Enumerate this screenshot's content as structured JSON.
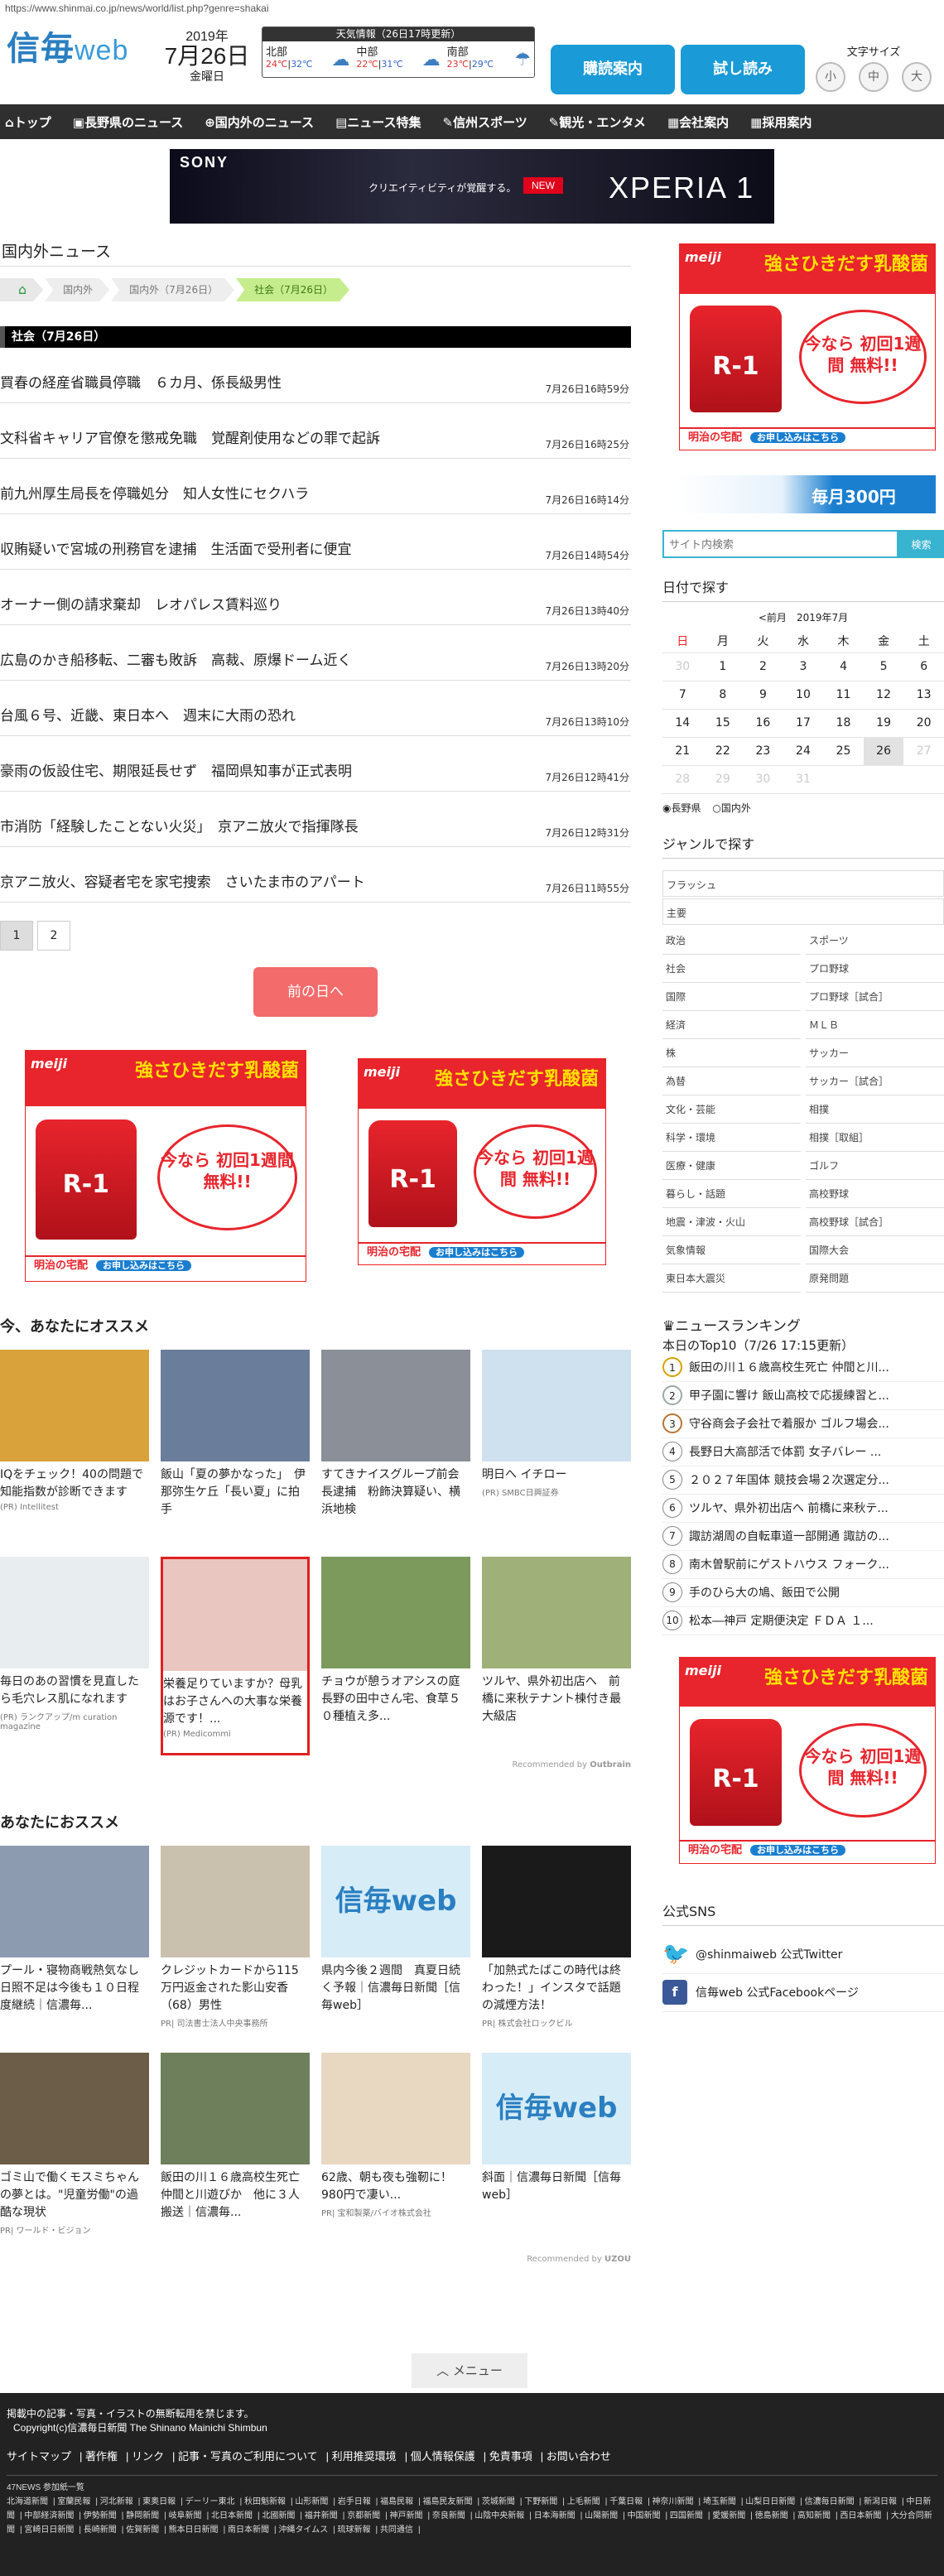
{
  "url": "https://www.shinmai.co.jp/news/world/list.php?genre=shakai",
  "header": {
    "logo": "信毎",
    "logo_web": "web",
    "year": "2019年",
    "month_day": "7月26日",
    "weekday": "金曜日",
    "weather": {
      "title": "天気情報（26日17時更新）",
      "areas": [
        {
          "name": "北部",
          "hi": "24℃",
          "lo": "32℃"
        },
        {
          "name": "中部",
          "hi": "22℃",
          "lo": "31℃"
        },
        {
          "name": "南部",
          "hi": "23℃",
          "lo": "29℃"
        }
      ]
    },
    "btn_subscribe": "購読案内",
    "btn_trial": "試し読み",
    "font_size_label": "文字サイズ",
    "font_small": "小",
    "font_medium": "中",
    "font_large": "大"
  },
  "nav": [
    "トップ",
    "長野県のニュース",
    "国内外のニュース",
    "ニュース特集",
    "信州スポーツ",
    "観光・エンタメ",
    "会社案内",
    "採用案内"
  ],
  "top_ad": {
    "brand": "SONY",
    "catch": "クリエイティビティが覚醒する。",
    "new": "NEW",
    "product": "XPERIA 1"
  },
  "main": {
    "section_title": "国内外ニュース",
    "breadcrumb": [
      "国内外",
      "国内外（7月26日）",
      "社会（7月26日）"
    ],
    "list_header": "社会（7月26日）",
    "news": [
      {
        "title": "買春の経産省職員停職　６カ月、係長級男性",
        "time": "7月26日16時59分"
      },
      {
        "title": "文科省キャリア官僚を懲戒免職　覚醒剤使用などの罪で起訴",
        "time": "7月26日16時25分"
      },
      {
        "title": "前九州厚生局長を停職処分　知人女性にセクハラ",
        "time": "7月26日16時14分"
      },
      {
        "title": "収賄疑いで宮城の刑務官を逮捕　生活面で受刑者に便宜",
        "time": "7月26日14時54分"
      },
      {
        "title": "オーナー側の請求棄却　レオパレス賃料巡り",
        "time": "7月26日13時40分"
      },
      {
        "title": "広島のかき船移転、二審も敗訴　高裁、原爆ドーム近く",
        "time": "7月26日13時20分"
      },
      {
        "title": "台風６号、近畿、東日本へ　週末に大雨の恐れ",
        "time": "7月26日13時10分"
      },
      {
        "title": "豪雨の仮設住宅、期限延長せず　福岡県知事が正式表明",
        "time": "7月26日12時41分"
      },
      {
        "title": "市消防「経験したことない火災」　京アニ放火で指揮隊長",
        "time": "7月26日12時31分"
      },
      {
        "title": "京アニ放火、容疑者宅を家宅捜索　さいたま市のアパート",
        "time": "7月26日11時55分"
      }
    ],
    "pages": [
      "1",
      "2"
    ],
    "prev_day": "前の日へ"
  },
  "meiji_ad": {
    "logo": "meiji",
    "catch": "強さひきだす乳酸菌",
    "product": "R-1",
    "offer": "今なら 初回1週間 無料!!",
    "foot": "明治の宅配",
    "apply": "お申し込みはこちら"
  },
  "reco1": {
    "title": "今、あなたにオススメ",
    "cards": [
      {
        "text": "IQをチェック！40の問題で知能指数が診断できます",
        "src": "(PR) Intellitest",
        "color": "#d9a23a"
      },
      {
        "text": "飯山「夏の夢かなった」　伊那弥生ケ丘「長い夏」に拍手",
        "src": "",
        "color": "#6a7d9a"
      },
      {
        "text": "すてきナイスグループ前会長逮捕　粉飾決算疑い、横浜地検",
        "src": "",
        "color": "#8a8f98"
      },
      {
        "text": "明日へ イチロー",
        "src": "(PR) SMBC日興証券",
        "color": "#cfe0ef"
      },
      {
        "text": "毎日のあの習慣を見直したら毛穴レス肌になれます",
        "src": "(PR) ランクアップ/m curation magazine",
        "color": "#e8eef0"
      },
      {
        "text": "栄養足りていますか？母乳はお子さんへの大事な栄養源です！...",
        "src": "(PR) Medicommi",
        "color": "#e9c7c0"
      },
      {
        "text": "チョウが憩うオアシスの庭　長野の田中さん宅、食草５０種植え多...",
        "src": "",
        "color": "#7b9a5c"
      },
      {
        "text": "ツルヤ、県外初出店へ　前橋に来秋テナント棟付き最大級店",
        "src": "",
        "color": "#9fb078"
      }
    ],
    "recommended": "Recommended by",
    "provider": "Outbrain"
  },
  "reco2": {
    "title": "あなたにおススメ",
    "cards": [
      {
        "text": "プール・寝物商戦熱気なし　日照不足は今後も１０日程度継続｜信濃毎...",
        "src": "",
        "color": "#8d9bb0"
      },
      {
        "text": "クレジットカードから115万円返金された影山安香（68）男性",
        "src": "PR| 司法書士法人中央事務所",
        "color": "#c9c0ad"
      },
      {
        "text": "県内今後２週間　真夏日続く予報｜信濃毎日新聞［信毎web］",
        "src": "",
        "color": "#d6ecf7"
      },
      {
        "text": "「加熱式たばこの時代は終わった！」インスタで話題の減煙方法！",
        "src": "PR| 株式会社ロックビル",
        "color": "#1a1a1a"
      },
      {
        "text": "ゴミ山で働くモスミちゃんの夢とは。\"児童労働\"の過酷な現状",
        "src": "PR| ワールド・ビジョン",
        "color": "#6b5d48"
      },
      {
        "text": "飯田の川１６歳高校生死亡　仲間と川遊びか　他に３人搬送｜信濃毎...",
        "src": "",
        "color": "#6e7f5c"
      },
      {
        "text": "62歳、朝も夜も強靭に！980円で凄い...",
        "src": "PR| 宝和製薬/バイオ株式会社",
        "color": "#e8d8c2"
      },
      {
        "text": "斜面｜信濃毎日新聞［信毎web］",
        "src": "",
        "color": "#d6ecf7"
      }
    ],
    "recommended": "Recommended by",
    "provider": "UZOU"
  },
  "side": {
    "banner": "毎月300円",
    "search_placeholder": "サイト内検索",
    "search_btn": "検索",
    "date_title": "日付で探す",
    "cal_prev": "<前月",
    "cal_month": "2019年7月",
    "weekdays": [
      "日",
      "月",
      "火",
      "水",
      "木",
      "金",
      "土"
    ],
    "weeks": [
      [
        "30",
        "1",
        "2",
        "3",
        "4",
        "5",
        "6"
      ],
      [
        "7",
        "8",
        "9",
        "10",
        "11",
        "12",
        "13"
      ],
      [
        "14",
        "15",
        "16",
        "17",
        "18",
        "19",
        "20"
      ],
      [
        "21",
        "22",
        "23",
        "24",
        "25",
        "26",
        "27"
      ],
      [
        "28",
        "29",
        "30",
        "31",
        "",
        "",
        ""
      ]
    ],
    "radio1": "長野県",
    "radio2": "国内外",
    "genre_title": "ジャンルで探す",
    "genre_full": [
      "フラッシュ",
      "主要"
    ],
    "genres": [
      "政治",
      "スポーツ",
      "社会",
      "プロ野球",
      "国際",
      "プロ野球［試合］",
      "経済",
      "ＭＬＢ",
      "株",
      "サッカー",
      "為替",
      "サッカー［試合］",
      "文化・芸能",
      "相撲",
      "科学・環境",
      "相撲［取組］",
      "医療・健康",
      "ゴルフ",
      "暮らし・話題",
      "高校野球",
      "地震・津波・火山",
      "高校野球［試合］",
      "気象情報",
      "国際大会",
      "東日本大震災",
      "原発問題"
    ],
    "rank_title": "ニュースランキング",
    "rank_sub": "本日のTop10（7/26 17:15更新）",
    "ranking": [
      "飯田の川１６歳高校生死亡 仲間と川...",
      "甲子園に響け 飯山高校で応援練習と...",
      "守谷商会子会社で着服か ゴルフ場会...",
      "長野日大高部活で体罰 女子バレー ...",
      "２０２７年国体 競技会場２次選定分...",
      "ツルヤ、県外初出店へ 前橋に来秋テ...",
      "諏訪湖周の自転車道一部開通 諏訪の...",
      "南木曽駅前にゲストハウス フォーク...",
      "手のひら大の鳩、飯田で公開",
      "松本―神戸 定期便決定 ＦＤＡ １..."
    ],
    "sns_title": "公式SNS",
    "twitter": "@shinmaiweb 公式Twitter",
    "facebook": "信毎web 公式Facebookページ"
  },
  "footer": {
    "menu": "メニュー",
    "notice": "掲載中の記事・写真・イラストの無断転用を禁じます。",
    "copyright": "Copyright(c)信濃毎日新聞 The Shinano Mainichi Shimbun",
    "links": [
      "サイトマップ",
      "著作権",
      "リンク",
      "記事・写真のご利用について",
      "利用推奨環境",
      "個人情報保護",
      "免責事項",
      "お問い合わせ"
    ],
    "partners_title": "47NEWS 参加紙一覧",
    "partners": [
      "北海道新聞",
      "室蘭民報",
      "河北新報",
      "東奥日報",
      "デーリー東北",
      "秋田魁新報",
      "山形新聞",
      "岩手日報",
      "福島民報",
      "福島民友新聞",
      "茨城新聞",
      "下野新聞",
      "上毛新聞",
      "千葉日報",
      "神奈川新聞",
      "埼玉新聞",
      "山梨日日新聞",
      "信濃毎日新聞",
      "新潟日報",
      "中日新聞",
      "中部経済新聞",
      "伊勢新聞",
      "静岡新聞",
      "岐阜新聞",
      "北日本新聞",
      "北國新聞",
      "福井新聞",
      "京都新聞",
      "神戸新聞",
      "奈良新聞",
      "山陰中央新報",
      "日本海新聞",
      "山陽新聞",
      "中国新聞",
      "四国新聞",
      "愛媛新聞",
      "徳島新聞",
      "高知新聞",
      "西日本新聞",
      "大分合同新聞",
      "宮崎日日新聞",
      "長崎新聞",
      "佐賀新聞",
      "熊本日日新聞",
      "南日本新聞",
      "沖縄タイムス",
      "琉球新報",
      "共同通信"
    ]
  }
}
